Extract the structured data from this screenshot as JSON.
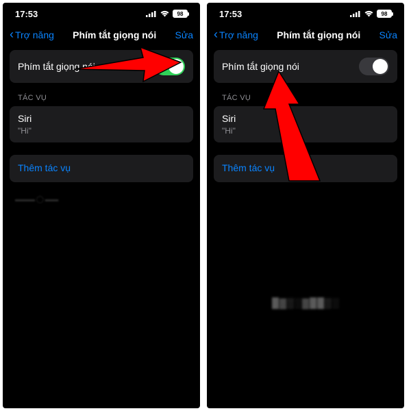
{
  "left": {
    "time": "17:53",
    "battery": "98",
    "back_label": "Trợ năng",
    "title": "Phím tắt giọng nói",
    "edit": "Sửa",
    "toggle_label": "Phím tắt giọng nói",
    "toggle_on": true,
    "section_header": "TÁC VỤ",
    "task_title": "Siri",
    "task_sub": "\"Hi\"",
    "add_label": "Thêm tác vụ"
  },
  "right": {
    "time": "17:53",
    "battery": "98",
    "back_label": "Trợ năng",
    "title": "Phím tắt giọng nói",
    "edit": "Sửa",
    "toggle_label": "Phím tắt giọng nói",
    "toggle_on": false,
    "section_header": "TÁC VỤ",
    "task_title": "Siri",
    "task_sub": "\"Hi\"",
    "add_label": "Thêm tác vụ"
  }
}
